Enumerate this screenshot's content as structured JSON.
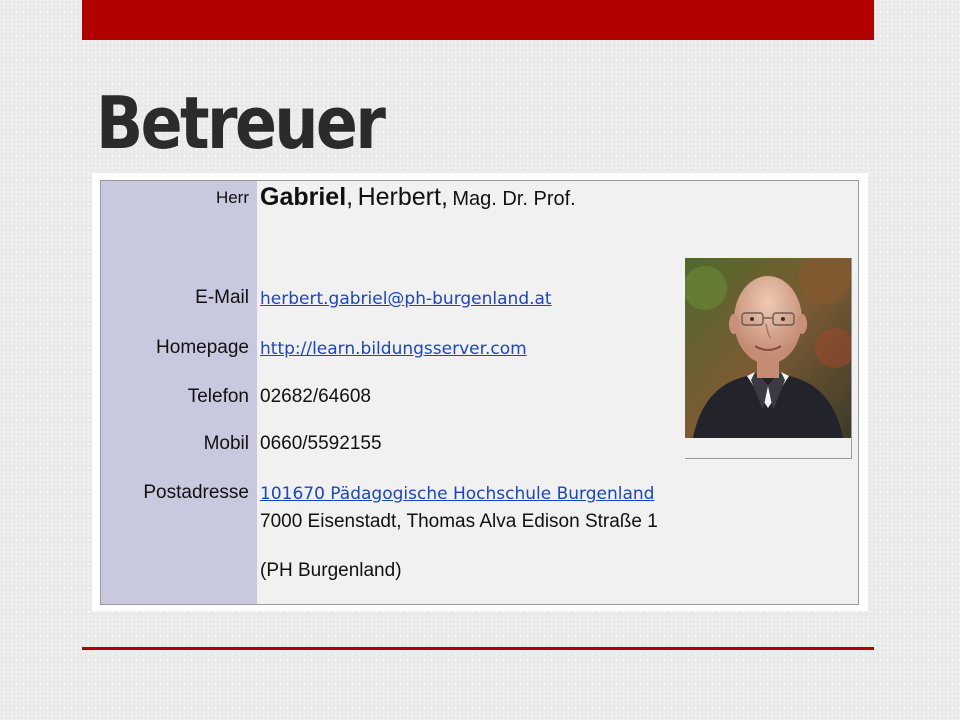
{
  "slide": {
    "title": "Betreuer"
  },
  "contact": {
    "salutation": "Herr",
    "surname": "Gabriel",
    "comma1": ",",
    "first_name": "Herbert",
    "comma2": ",",
    "titles": "Mag. Dr. Prof.",
    "rows": [
      {
        "label": "E-Mail",
        "value": "herbert.gabriel@ph-burgenland.at"
      },
      {
        "label": "Homepage",
        "value": "http://learn.bildungsserver.com"
      },
      {
        "label": "Telefon",
        "value": "02682/64608"
      },
      {
        "label": "Mobil",
        "value": "0660/5592155"
      }
    ],
    "postal": {
      "label": "Postadresse",
      "link": "101670 Pädagogische Hochschule Burgenland",
      "line2": "7000 Eisenstadt, Thomas Alva Edison Straße 1",
      "line3": "(PH Burgenland)"
    }
  },
  "colors": {
    "accent": "#b20000",
    "label_bg": "#c8c9df",
    "link": "#1a45c8",
    "title": "#2b2b2b"
  }
}
